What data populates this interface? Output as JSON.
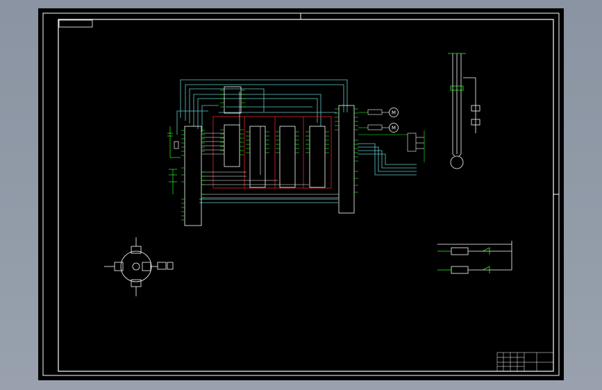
{
  "drawing": {
    "motor_symbol": "M",
    "background_color": "#000000",
    "wire_colors": {
      "signal": "#ffffff",
      "bus": "#22ff22",
      "control": "#66cccc",
      "power": "#cc2222"
    }
  },
  "title_block": {
    "name": "",
    "scale": ""
  }
}
